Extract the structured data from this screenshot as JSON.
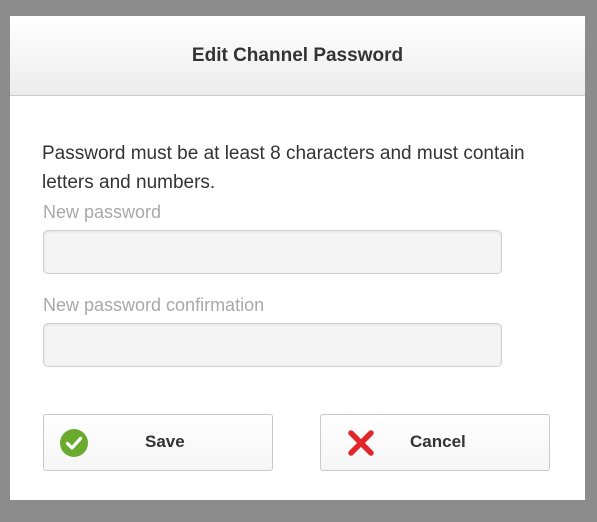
{
  "dialog": {
    "title": "Edit Channel Password",
    "info_text": "Password must be at least 8 characters and must contain letters and numbers.",
    "fields": {
      "new_password": {
        "label": "New password",
        "value": "",
        "placeholder": ""
      },
      "confirm_password": {
        "label": "New password confirmation",
        "value": "",
        "placeholder": ""
      }
    },
    "buttons": {
      "save": {
        "label": "Save",
        "icon": "check-circle-icon",
        "icon_color": "#6aaa2d"
      },
      "cancel": {
        "label": "Cancel",
        "icon": "close-x-icon",
        "icon_color": "#e0282a"
      }
    }
  }
}
